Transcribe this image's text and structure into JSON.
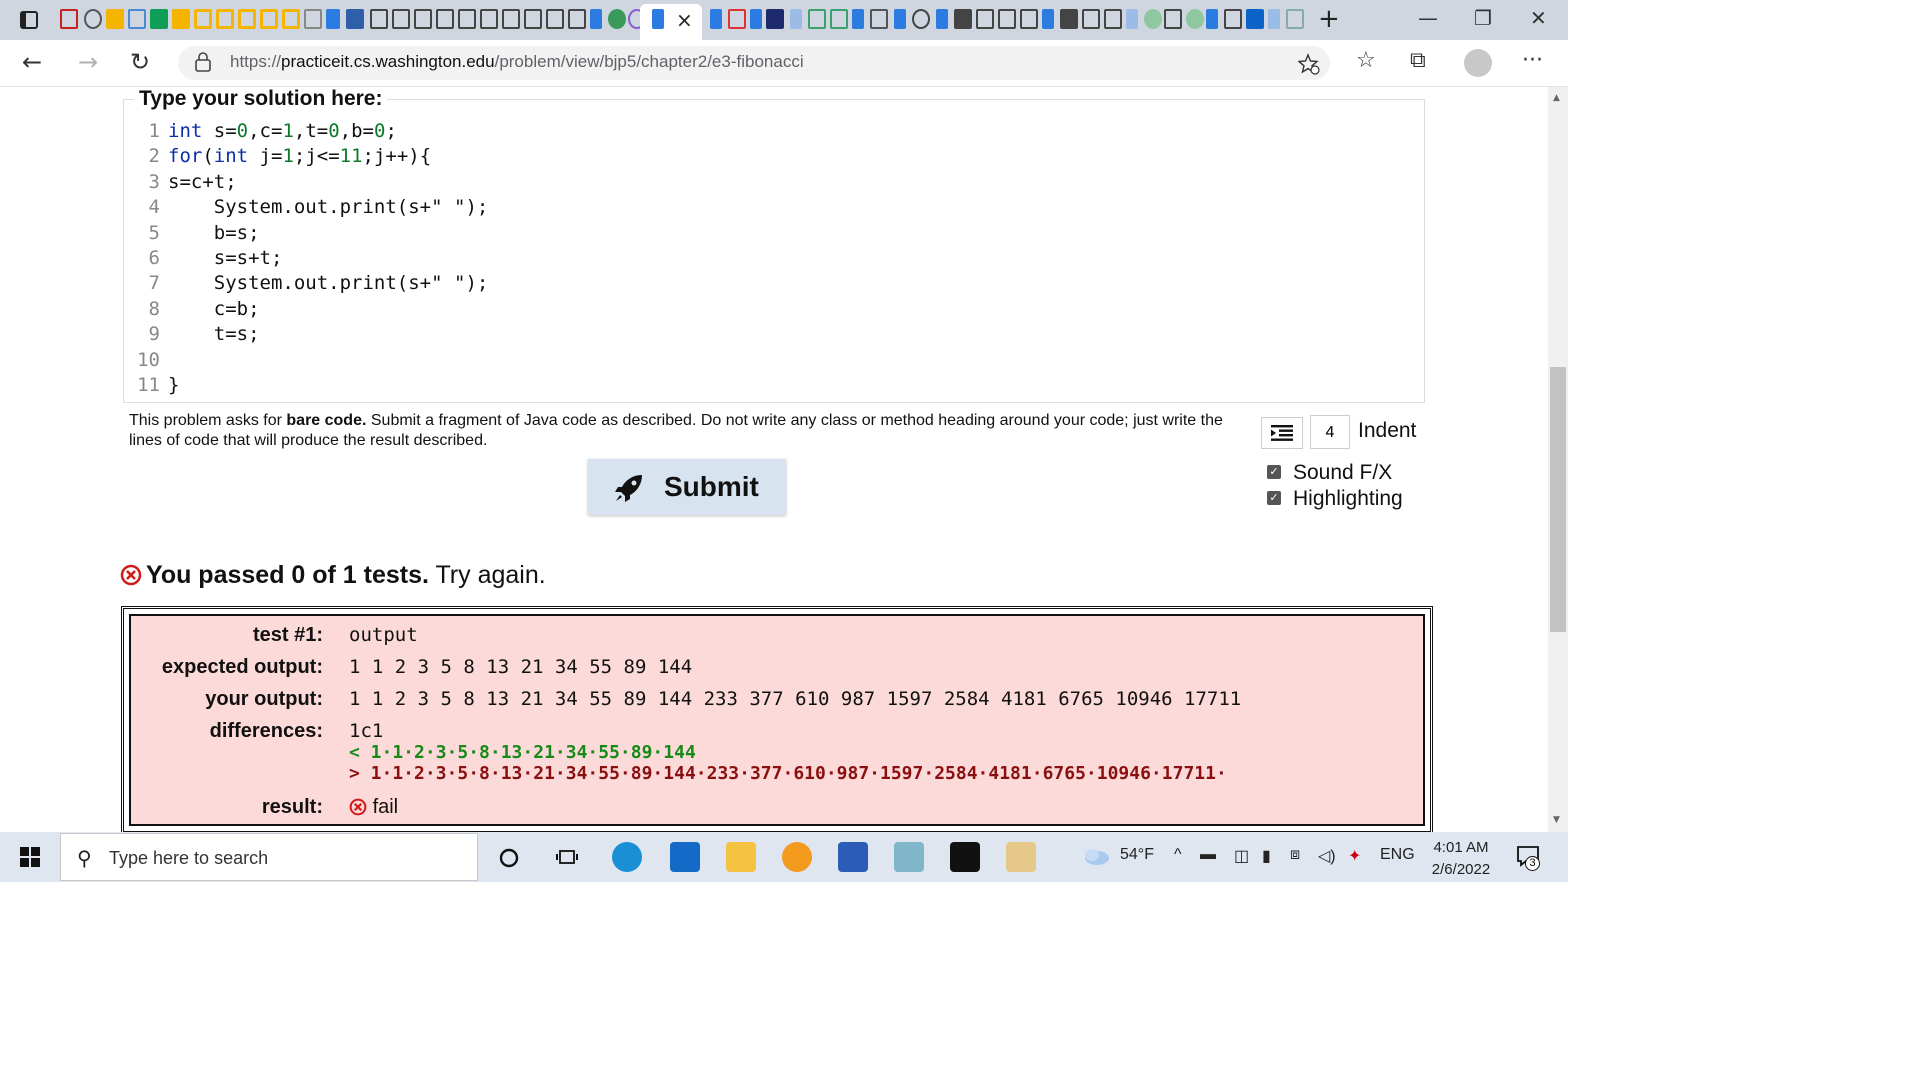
{
  "browser": {
    "url_prefix": "https://",
    "url_domain": "practiceit.cs.washington.edu",
    "url_path": "/problem/view/bjp5/chapter2/e3-fibonacci",
    "tab_close": "×",
    "new_tab": "+",
    "win_min": "—",
    "win_max": "❐",
    "win_close": "✕"
  },
  "editor": {
    "legend": "Type your solution here:",
    "line_numbers": [
      "1",
      "2",
      "3",
      "4",
      "5",
      "6",
      "7",
      "8",
      "9",
      "10",
      "11"
    ]
  },
  "instructions": {
    "prefix": "This problem asks for ",
    "bold": "bare code.",
    "rest": " Submit a fragment of Java code as described. Do not write any class or method heading around your code; just write the lines of code that will produce the result described."
  },
  "controls": {
    "indent_value": "4",
    "indent_label": "Indent",
    "sound_label": "Sound F/X",
    "highlight_label": "Highlighting",
    "submit_label": "Submit"
  },
  "result": {
    "passed_text": "You passed 0 of 1 tests.",
    "try_again": "Try again.",
    "labels": {
      "test": "test #1:",
      "expected": "expected output:",
      "yours": "your output:",
      "differences": "differences:",
      "result": "result:"
    },
    "test_value": "output",
    "expected_value": "1 1 2 3 5 8 13 21 34 55 89 144",
    "your_value": "1 1 2 3 5 8 13 21 34 55 89 144 233 377 610 987 1597 2584 4181 6765 10946 17711",
    "diff_header": "1c1",
    "diff_expected": "< 1·1·2·3·5·8·13·21·34·55·89·144",
    "diff_yours": "> 1·1·2·3·5·8·13·21·34·55·89·144·233·377·610·987·1597·2584·4181·6765·10946·17711·",
    "result_value": "fail"
  },
  "taskbar": {
    "search_placeholder": "Type here to search",
    "weather": "54°F",
    "language": "ENG",
    "time": "4:01 AM",
    "date": "2/6/2022",
    "notification_count": "3"
  },
  "colors": {
    "fail_bg": "#fddada",
    "diff_green": "#178a17",
    "diff_red": "#8a1010",
    "fail_icon": "#d11a1a",
    "submit_bg": "#d7e3ee"
  }
}
